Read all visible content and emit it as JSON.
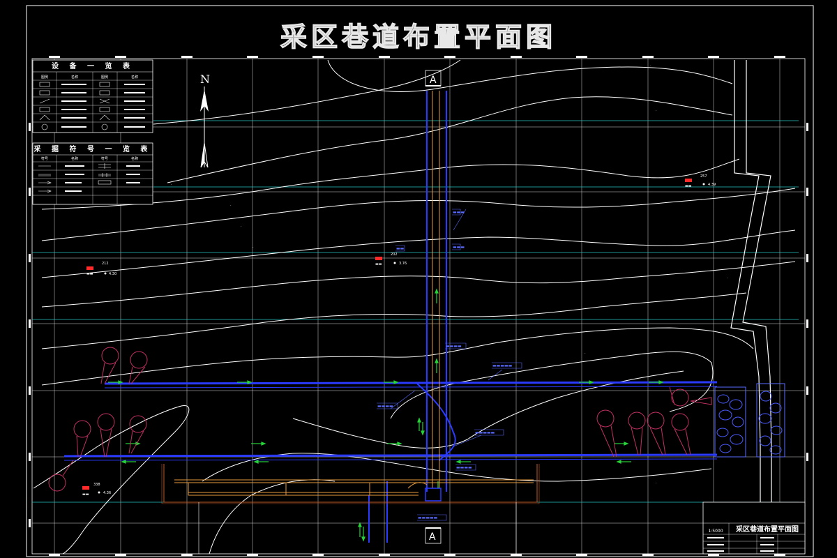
{
  "title": "采区巷道布置平面图",
  "equipment_table": {
    "title": "设 备 一 览 表",
    "headers": [
      "图例",
      "名称",
      "图例",
      "名称"
    ]
  },
  "symbol_table": {
    "title": "采 掘 符 号 一 览 表",
    "headers": [
      "符号",
      "名称",
      "符号",
      "名称"
    ]
  },
  "north_arrow": {
    "label": "N"
  },
  "section_markers": {
    "top": "A",
    "bottom": "A"
  },
  "boreholes": [
    {
      "id": "212",
      "elev": "4.30"
    },
    {
      "id": "202",
      "elev": "3.76"
    },
    {
      "id": "257",
      "elev": "4.39"
    },
    {
      "id": "338",
      "elev": "4.36"
    }
  ],
  "title_block": {
    "drawing_name": "采区巷道布置平面图",
    "scale": "1:5000"
  },
  "colors": {
    "contour": "#ffffff",
    "grid": "#ffffff",
    "strike_line": "#27c4c4",
    "roadway": "#2a3bff",
    "roadway_outline": "#5a6bff",
    "shaft_inner": "#e89a3c",
    "arrow": "#27d43a",
    "fault": "#ff2a2a",
    "equipment": "#c03060"
  }
}
